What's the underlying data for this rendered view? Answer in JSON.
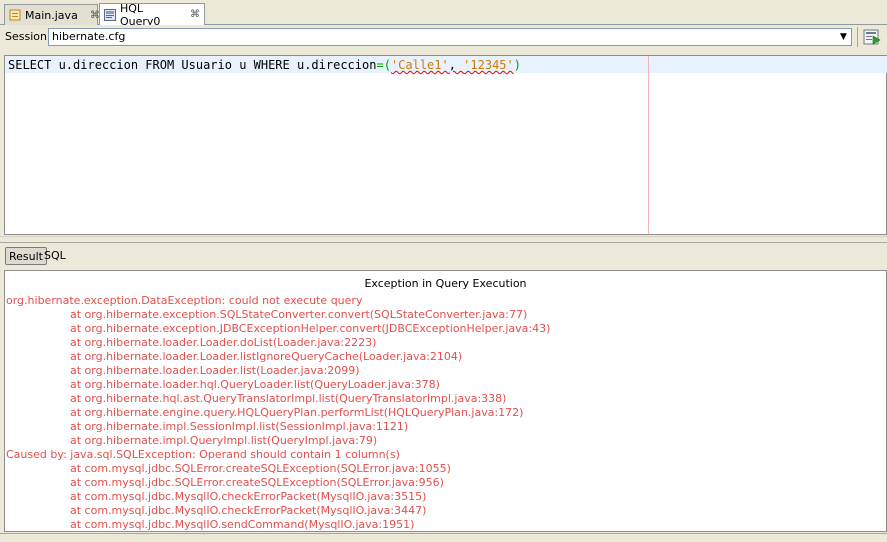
{
  "tabs": [
    {
      "label": "Main.java",
      "close": "⌘",
      "active": false
    },
    {
      "label": "HQL Query0",
      "close": "⌘",
      "active": true
    }
  ],
  "session": {
    "label": "Session:",
    "value": "hibernate.cfg"
  },
  "editor": {
    "query_part1": "SELECT u.direccion FROM Usuario u WHERE u.direccion",
    "query_op": "=(",
    "query_str1": "'Calle1'",
    "query_comma": ", ",
    "query_str2": "'12345'",
    "query_close": ")"
  },
  "result_tabs": {
    "result": "Result",
    "sql": "SQL"
  },
  "result": {
    "header": "Exception in Query Execution",
    "lines": [
      {
        "text": "org.hibernate.exception.DataException: could not execute query",
        "indent": false
      },
      {
        "text": "at org.hibernate.exception.SQLStateConverter.convert(SQLStateConverter.java:77)",
        "indent": true
      },
      {
        "text": "at org.hibernate.exception.JDBCExceptionHelper.convert(JDBCExceptionHelper.java:43)",
        "indent": true
      },
      {
        "text": "at org.hibernate.loader.Loader.doList(Loader.java:2223)",
        "indent": true
      },
      {
        "text": "at org.hibernate.loader.Loader.listIgnoreQueryCache(Loader.java:2104)",
        "indent": true
      },
      {
        "text": "at org.hibernate.loader.Loader.list(Loader.java:2099)",
        "indent": true
      },
      {
        "text": "at org.hibernate.loader.hql.QueryLoader.list(QueryLoader.java:378)",
        "indent": true
      },
      {
        "text": "at org.hibernate.hql.ast.QueryTranslatorImpl.list(QueryTranslatorImpl.java:338)",
        "indent": true
      },
      {
        "text": "at org.hibernate.engine.query.HQLQueryPlan.performList(HQLQueryPlan.java:172)",
        "indent": true
      },
      {
        "text": "at org.hibernate.impl.SessionImpl.list(SessionImpl.java:1121)",
        "indent": true
      },
      {
        "text": "at org.hibernate.impl.QueryImpl.list(QueryImpl.java:79)",
        "indent": true
      },
      {
        "text": "Caused by: java.sql.SQLException: Operand should contain 1 column(s)",
        "indent": false
      },
      {
        "text": "at com.mysql.jdbc.SQLError.createSQLException(SQLError.java:1055)",
        "indent": true
      },
      {
        "text": "at com.mysql.jdbc.SQLError.createSQLException(SQLError.java:956)",
        "indent": true
      },
      {
        "text": "at com.mysql.jdbc.MysqlIO.checkErrorPacket(MysqlIO.java:3515)",
        "indent": true
      },
      {
        "text": "at com.mysql.jdbc.MysqlIO.checkErrorPacket(MysqlIO.java:3447)",
        "indent": true
      },
      {
        "text": "at com.mysql.jdbc.MysqlIO.sendCommand(MysqlIO.java:1951)",
        "indent": true
      }
    ]
  },
  "colors": {
    "error_text": "#e0504f",
    "operator": "#00a000",
    "string": "#ce7b00",
    "current_line": "#e8f2fe"
  },
  "icons": {
    "main_tab": "java-file-icon",
    "query_tab": "hql-query-icon",
    "run": "run-query-icon"
  }
}
